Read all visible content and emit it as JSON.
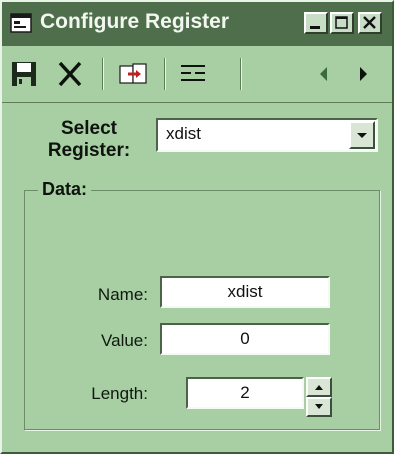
{
  "window": {
    "title": "Configure Register",
    "icons": [
      "form-icon",
      "minimize-icon",
      "maximize-icon",
      "close-icon"
    ]
  },
  "toolbar": {
    "icons": [
      "save-icon",
      "delete-icon",
      "export-icon",
      "list-icon",
      "prev-icon",
      "next-icon"
    ]
  },
  "register": {
    "label": "Select Register:",
    "selected": "xdist"
  },
  "data_group": {
    "title": "Data:",
    "name_label": "Name:",
    "name_value": "xdist",
    "value_label": "Value:",
    "value_value": "0",
    "length_label": "Length:",
    "length_value": "2"
  },
  "colors": {
    "background": "#a7cfa3",
    "titlebar": "#4f6e4b"
  }
}
